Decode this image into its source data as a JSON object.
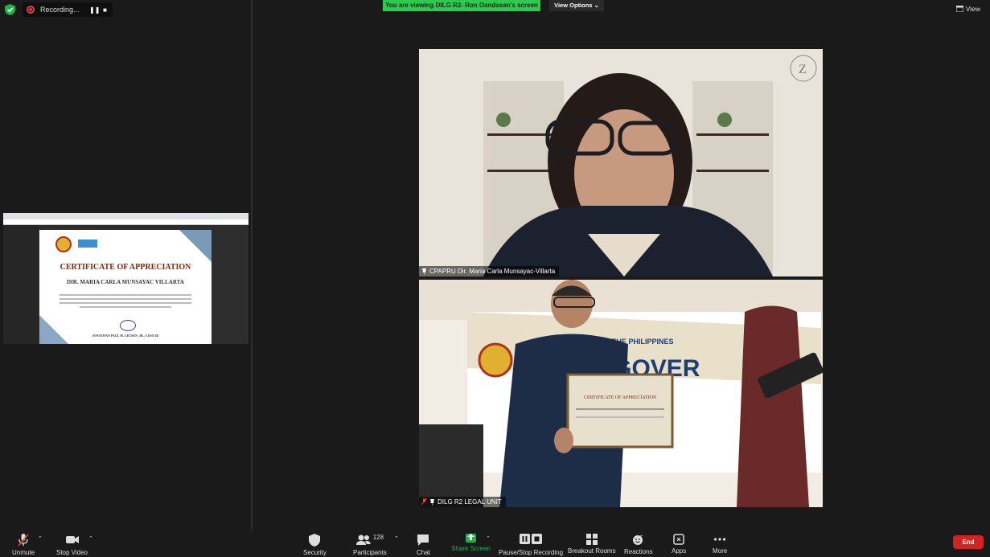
{
  "topbar": {
    "recording_label": "Recording...",
    "viewing_banner": "You are viewing DILG R2- Ron Oandasan's screen",
    "view_options_label": "View Options",
    "view_label": "View"
  },
  "shared_screen": {
    "certificate_title": "CERTIFICATE OF APPRECIATION",
    "recipient_name": "DIR. MARIA CARLA MUNSAYAC VILLARTA",
    "signer_name": "JONATHAN PAUL M. LEUSEN, JR., CESO III"
  },
  "videos": [
    {
      "name": "CPAPRU Dir. Maria Carla Munsayac-Villarta",
      "muted": false
    },
    {
      "name": "DILG R2 LEGAL UNIT",
      "muted": true
    }
  ],
  "toolbar": {
    "unmute": "Unmute",
    "stop_video": "Stop Video",
    "security": "Security",
    "participants": "Participants",
    "participant_count": "128",
    "chat": "Chat",
    "share_screen": "Share Screen",
    "pause_recording": "Pause/Stop Recording",
    "breakout": "Breakout Rooms",
    "reactions": "Reactions",
    "apps": "Apps",
    "more": "More",
    "end": "End"
  },
  "colors": {
    "viewing_banner": "#2ec94f",
    "share_screen_green": "#22b14c",
    "end_red": "#d32424",
    "recording_red": "#e04040",
    "background": "#1a1a1a"
  }
}
